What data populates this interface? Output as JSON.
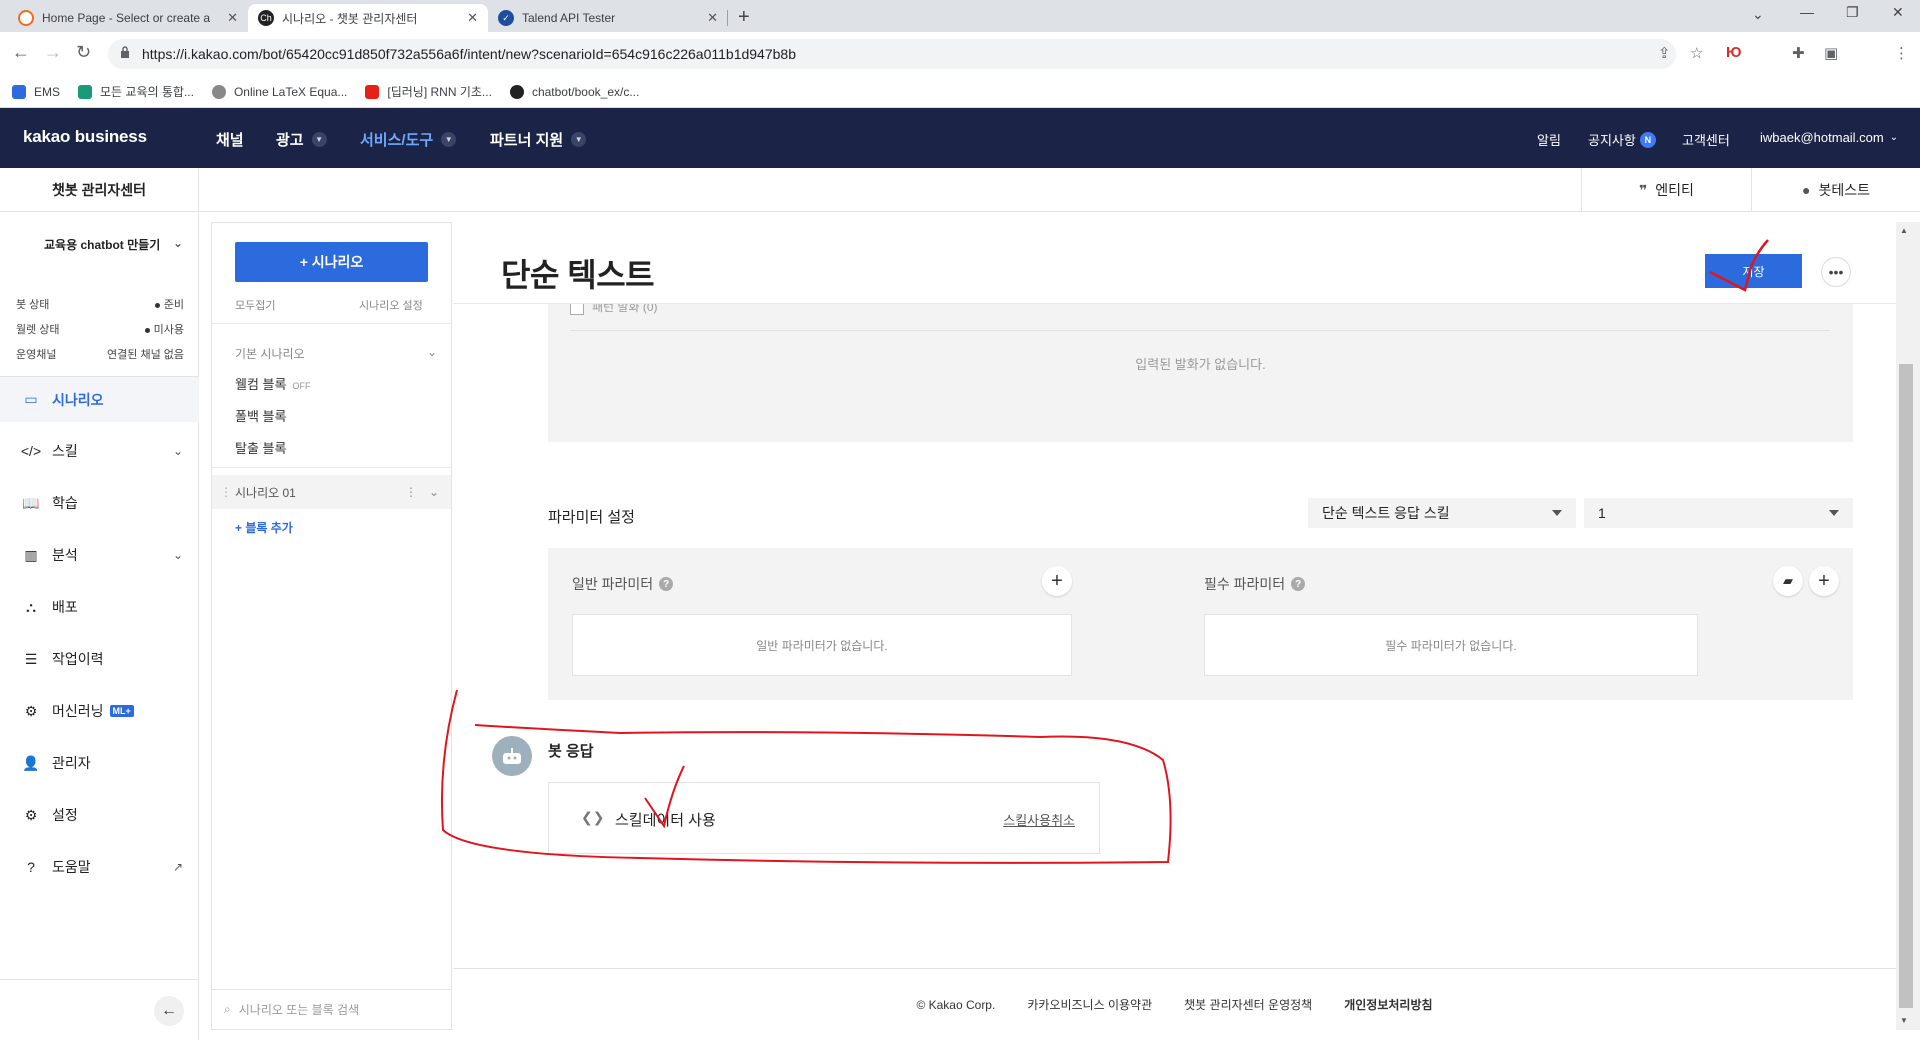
{
  "browser": {
    "tabs": [
      {
        "title": "Home Page - Select or create a",
        "active": false
      },
      {
        "title": "시나리오 - 챗봇 관리자센터",
        "active": true
      },
      {
        "title": "Talend API Tester",
        "active": false
      }
    ],
    "url": "https://i.kakao.com/bot/65420cc91d850f732a556a6f/intent/new?scenarioId=654c916c226a011b1d947b8b",
    "ext_label": "Ю",
    "bookmarks": [
      "EMS",
      "모든 교육의 통합...",
      "Online LaTeX Equa...",
      "[딥러닝] RNN 기초...",
      "chatbot/book_ex/c..."
    ]
  },
  "header": {
    "logo": "kakao business",
    "nav": [
      "채널",
      "광고",
      "서비스/도구",
      "파트너 지원"
    ],
    "right": {
      "alarm": "알림",
      "notice": "공지사항",
      "notice_badge": "N",
      "support": "고객센터",
      "account": "iwbaek@hotmail.com"
    }
  },
  "subheader": {
    "title": "챗봇 관리자센터",
    "entity": "엔티티",
    "bottest": "봇테스트"
  },
  "sidebar": {
    "bot_name": "교육용 chatbot 만들기",
    "status": [
      {
        "label": "봇 상태",
        "value": "준비"
      },
      {
        "label": "월렛 상태",
        "value": "미사용"
      },
      {
        "label": "운영채널",
        "value": "연결된 채널 없음"
      }
    ],
    "menu": [
      {
        "label": "시나리오",
        "icon": "scenario-icon"
      },
      {
        "label": "스킬",
        "icon": "code-icon"
      },
      {
        "label": "학습",
        "icon": "book-icon"
      },
      {
        "label": "분석",
        "icon": "chart-icon"
      },
      {
        "label": "배포",
        "icon": "deploy-icon"
      },
      {
        "label": "작업이력",
        "icon": "history-icon"
      },
      {
        "label": "머신러닝",
        "icon": "chip-icon",
        "badge": "ML+"
      },
      {
        "label": "관리자",
        "icon": "admin-icon"
      },
      {
        "label": "설정",
        "icon": "gear-icon"
      },
      {
        "label": "도움말",
        "icon": "help-icon"
      }
    ]
  },
  "scenario_panel": {
    "add_button": "+ 시나리오",
    "collapse_all": "모두접기",
    "scenario_settings": "시나리오 설정",
    "default_section": "기본 시나리오",
    "default_blocks": [
      "웰컴 블록",
      "폴백 블록",
      "탈출 블록"
    ],
    "welcome_off": "OFF",
    "scenario": "시나리오 01",
    "add_block": "+ 블록 추가",
    "search_placeholder": "시나리오 또는 블록 검색"
  },
  "main": {
    "block_title": "단순 텍스트",
    "save": "저장",
    "utterance_header": "패턴 발화 (0)",
    "utterance_empty": "입력된 발화가 없습니다.",
    "param_title": "파라미터 설정",
    "skill_select": "단순 텍스트 응답 스킬",
    "num_select": "1",
    "general_param": "일반 파라미터",
    "required_param": "필수 파라미터",
    "general_empty": "일반 파라미터가 없습니다.",
    "required_empty": "필수 파라미터가 없습니다.",
    "bot_response": "봇 응답",
    "skill_data": "스킬데이터 사용",
    "skill_cancel": "스킬사용취소"
  },
  "footer": {
    "copyright": "© Kakao Corp.",
    "terms": "카카오비즈니스 이용약관",
    "policy": "챗봇 관리자센터 운영정책",
    "privacy": "개인정보처리방침"
  },
  "colors": {
    "header_bg": "#1b2447",
    "accent": "#2c6bde",
    "annotation": "#e0161f"
  }
}
